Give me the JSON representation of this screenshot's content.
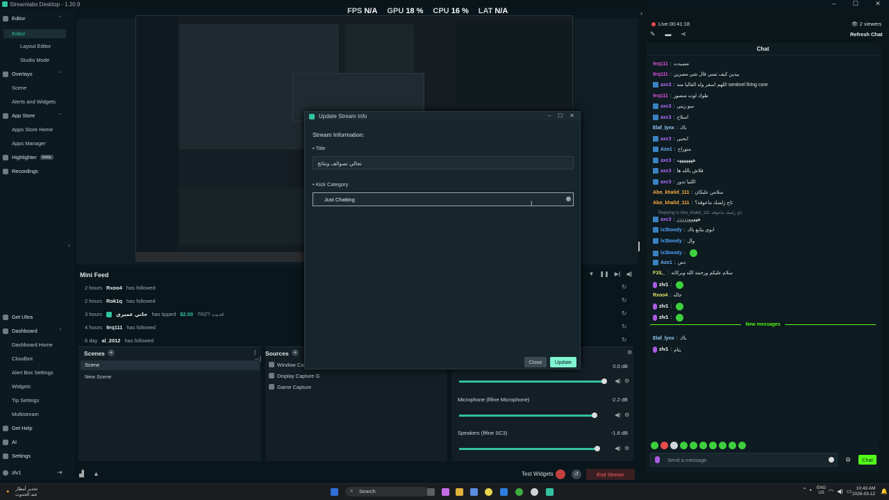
{
  "app": {
    "title": "Streamlabs Desktop - 1.20.9"
  },
  "stats": {
    "fps_label": "FPS",
    "fps": "N/A",
    "gpu_label": "GPU",
    "gpu": "18 %",
    "cpu_label": "CPU",
    "cpu": "16 %",
    "lat_label": "LAT",
    "lat": "N/A"
  },
  "sidebar": {
    "editor_group": "Editor",
    "editor_items": [
      "Editor",
      "Layout Editor",
      "Studio Mode"
    ],
    "overlays_group": "Overlays",
    "overlays_items": [
      "Scene",
      "Alerts and Widgets"
    ],
    "appstore_group": "App Store",
    "appstore_items": [
      "Apps Store Home",
      "Apps Manager"
    ],
    "highlighter": "Highlighter",
    "highlighter_badge": "beta",
    "recordings": "Recordings",
    "get_ultra": "Get Ultra",
    "dashboard_group": "Dashboard",
    "dashboard_items": [
      "Dashboard Home",
      "Cloudbot",
      "Alert Box Settings",
      "Widgets",
      "Tip Settings",
      "Multistream"
    ],
    "get_help": "Get Help",
    "ai": "AI",
    "settings": "Settings",
    "user": "zlv1"
  },
  "minifeed": {
    "title": "Mini Feed",
    "rows": [
      {
        "time": "2 hours",
        "name": "Rxoo4",
        "action": "has followed",
        "amount": "",
        "message": ""
      },
      {
        "time": "2 hours",
        "name": "Rok1q",
        "action": "has followed",
        "amount": "",
        "message": ""
      },
      {
        "time": "3 hours",
        "name": "حاتي عميري",
        "action": "has tipped",
        "amount": "$2.00",
        "message": "TRZ? قديت"
      },
      {
        "time": "4 hours",
        "name": "9rq111",
        "action": "has followed",
        "amount": "",
        "message": ""
      },
      {
        "time": "6 day",
        "name": "al_2012",
        "action": "has followed",
        "amount": "",
        "message": ""
      }
    ]
  },
  "scenes": {
    "title": "Scenes",
    "items": [
      "Scene",
      "New Scene"
    ]
  },
  "sources": {
    "title": "Sources",
    "items": [
      "Window Capture",
      "Display Capture G",
      "Game Capture"
    ]
  },
  "mixer": {
    "channels": [
      {
        "name": "",
        "db": "0.0 dB",
        "level": 0.98
      },
      {
        "name": "Microphone (fifine Microphone)",
        "db": "-2.2 dB",
        "level": 0.9
      },
      {
        "name": "Speakers (fifine SC3)",
        "db": "-1.8 dB",
        "level": 0.92
      }
    ]
  },
  "modal": {
    "title": "Update Stream Info",
    "section": "Stream Information:",
    "title_label": "Title",
    "title_value": "تحالي تصوالف ونتائج",
    "category_label": "Kick Category",
    "category_value": "Just Chatting",
    "close_label": "Close",
    "update_label": "Update"
  },
  "footer": {
    "test_widgets": "Test Widgets",
    "end_stream": "End Stream"
  },
  "live": {
    "status": "Live 00:41:18",
    "viewers": "2 viewers",
    "refresh": "Refresh Chat"
  },
  "chat": {
    "title": "Chat",
    "messages": [
      {
        "user": "9rq111",
        "text": "مصيدت",
        "color": "#d94fd9",
        "badge": false
      },
      {
        "user": "9rq111",
        "text": "بيدين كيف تسي قال شي مصرين",
        "color": "#d94fd9",
        "badge": false
      },
      {
        "user": "axc3",
        "text": "اللهم اسقر وله القاليا منه sentinel firing core",
        "color": "#b06dff",
        "badge": true
      },
      {
        "user": "9rq111",
        "text": "طوك لوت منصور",
        "color": "#d94fd9",
        "badge": false
      },
      {
        "user": "axc3",
        "text": "سو زيني",
        "color": "#b06dff",
        "badge": true
      },
      {
        "user": "axc3",
        "text": "اسلاح",
        "color": "#b06dff",
        "badge": true
      },
      {
        "user": "Elaf_lynx",
        "text": "باك",
        "color": "#9ad0ff",
        "badge": false
      },
      {
        "user": "axc3",
        "text": "ابحبي",
        "color": "#b06dff",
        "badge": true
      },
      {
        "user": "Azo1",
        "text": "متوراح",
        "color": "#6ab3ff",
        "badge": true
      },
      {
        "user": "axc3",
        "text": "هههههههه",
        "color": "#b06dff",
        "badge": true
      },
      {
        "user": "axc3",
        "text": "فلاش بالله ها",
        "color": "#b06dff",
        "badge": true
      },
      {
        "user": "axc3",
        "text": "اللتيا تدور",
        "color": "#b06dff",
        "badge": true
      },
      {
        "user": "Abo_khalid_111",
        "text": "سلامن عليكان",
        "color": "#ffae42",
        "badge": false
      },
      {
        "user": "Abo_khalid_111",
        "text": "تاج زلسك ماعوقة؟",
        "color": "#ffae42",
        "badge": false
      },
      {
        "user": "axc3",
        "text": "ههوووززززز",
        "color": "#b06dff",
        "badge": true
      },
      {
        "user": "lx3boody",
        "text": "ابوي يتابع باك",
        "color": "#4ea3ff",
        "badge": true
      },
      {
        "user": "lx3boody",
        "text": "وال",
        "color": "#4ea3ff",
        "badge": true
      },
      {
        "user": "lx3boody",
        "text": "",
        "color": "#4ea3ff",
        "badge": true
      },
      {
        "user": "Azo1",
        "text": "دس",
        "color": "#6ab3ff",
        "badge": true
      },
      {
        "user": "F1lL_",
        "text": "سلام عليكم ورحمة الله وبركاته",
        "color": "#e6e66a",
        "badge": false
      },
      {
        "user": "zlv1",
        "text": "",
        "color": "#ffffff",
        "badge": false
      },
      {
        "user": "Rxoo4",
        "text": "جاله",
        "color": "#e6e66a",
        "badge": false
      },
      {
        "user": "zlv1",
        "text": "",
        "color": "#ffffff",
        "badge": false
      },
      {
        "user": "zlv1",
        "text": "",
        "color": "#ffffff",
        "badge": false
      }
    ],
    "replying": "Replying to Abo_khalid_111: تاج زلسك ماعوقة",
    "new_messages": "New messages",
    "after": [
      {
        "user": "Elaf_lynx",
        "text": "باك",
        "color": "#9ad0ff",
        "badge": false
      },
      {
        "user": "zlv1",
        "text": "يتام",
        "color": "#ffffff",
        "badge": false
      }
    ],
    "placeholder": "Send a message",
    "send": "Chat"
  },
  "taskbar": {
    "news": "تحذير أمطار",
    "news2": "عند الحدوث",
    "search": "Search",
    "lang": "ENG",
    "lang2": "US",
    "time": "10:43 AM",
    "date": "2026-03-12"
  }
}
